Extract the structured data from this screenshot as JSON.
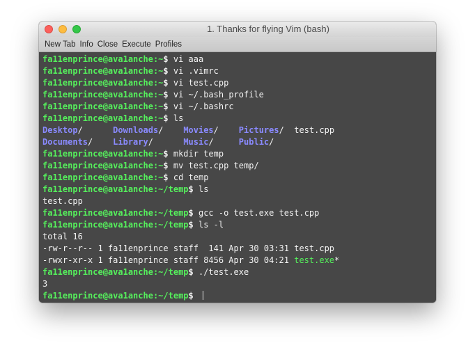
{
  "window": {
    "title": "1. Thanks for flying Vim (bash)"
  },
  "toolbar": {
    "items": [
      "New Tab",
      "Info",
      "Close",
      "Execute",
      "Profiles"
    ]
  },
  "colors": {
    "prompt": "#55f05c",
    "directory": "#8a8aff",
    "background": "#474747",
    "text": "#f2f2f2"
  },
  "terminal": {
    "prompt_user": "fa11enprince@ava1anche",
    "lines": [
      {
        "path": "~",
        "cmd": "vi aaa"
      },
      {
        "path": "~",
        "cmd": "vi .vimrc"
      },
      {
        "path": "~",
        "cmd": "vi test.cpp"
      },
      {
        "path": "~",
        "cmd": "vi ~/.bash_profile"
      },
      {
        "path": "~",
        "cmd": "vi ~/.bashrc"
      },
      {
        "path": "~",
        "cmd": "ls"
      },
      {
        "ls_row": [
          "Desktop",
          "Downloads",
          "Movies",
          "Pictures",
          "test.cpp"
        ]
      },
      {
        "ls_row": [
          "Documents",
          "Library",
          "Music",
          "Public"
        ]
      },
      {
        "path": "~",
        "cmd": "mkdir temp"
      },
      {
        "path": "~",
        "cmd": "mv test.cpp temp/"
      },
      {
        "path": "~",
        "cmd": "cd temp"
      },
      {
        "path": "~/temp",
        "cmd": "ls"
      },
      {
        "out": "test.cpp"
      },
      {
        "path": "~/temp",
        "cmd": "gcc -o test.exe test.cpp"
      },
      {
        "path": "~/temp",
        "cmd": "ls -l"
      },
      {
        "out": "total 16"
      },
      {
        "out": "-rw-r--r-- 1 fa11enprince staff  141 Apr 30 03:31 test.cpp"
      },
      {
        "out": "-rwxr-xr-x 1 fa11enprince staff 8456 Apr 30 04:21 ",
        "exe": "test.exe",
        "suffix": "*"
      },
      {
        "path": "~/temp",
        "cmd": "./test.exe"
      },
      {
        "out": "3"
      },
      {
        "path": "~/temp",
        "cmd": "",
        "cursor": true
      }
    ]
  }
}
